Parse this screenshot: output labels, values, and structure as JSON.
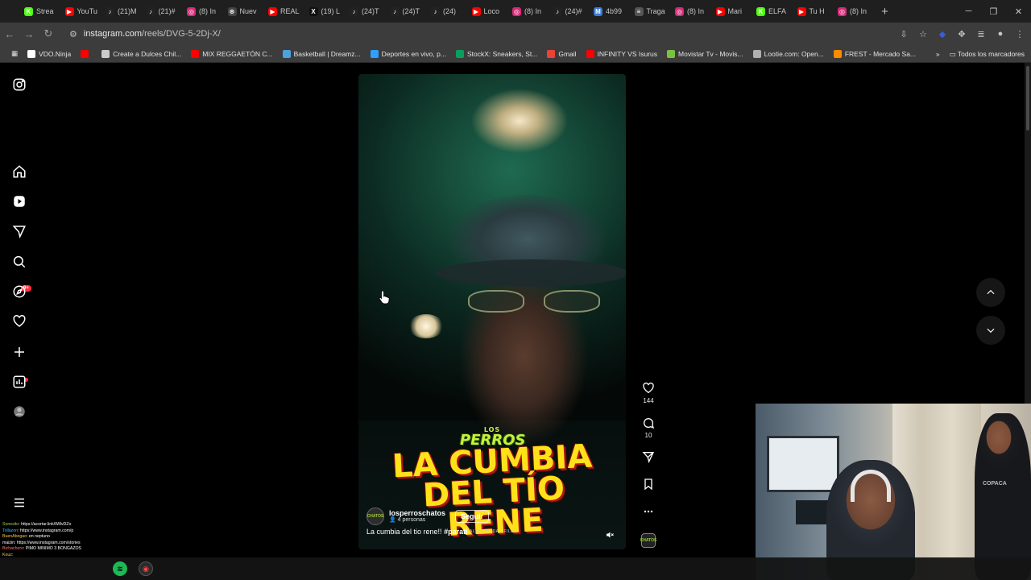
{
  "browser": {
    "tabs": [
      {
        "label": "Strea",
        "fav_color": "#53fc18",
        "fav_glyph": "K",
        "active": false
      },
      {
        "label": "YouTu",
        "fav_color": "#ff0000",
        "fav_glyph": "▶",
        "active": false
      },
      {
        "label": "(21)M",
        "fav_color": "#222222",
        "fav_glyph": "♪",
        "active": false
      },
      {
        "label": "(21)#",
        "fav_color": "#222222",
        "fav_glyph": "♪",
        "active": false
      },
      {
        "label": "(8) In",
        "fav_color": "#d62976",
        "fav_glyph": "◎",
        "active": false
      },
      {
        "label": "Nuev",
        "fav_color": "#444444",
        "fav_glyph": "⊛",
        "active": false
      },
      {
        "label": "REAL",
        "fav_color": "#ff0000",
        "fav_glyph": "▶",
        "active": false
      },
      {
        "label": "(19) L",
        "fav_color": "#111111",
        "fav_glyph": "X",
        "active": false
      },
      {
        "label": "(24)T",
        "fav_color": "#222222",
        "fav_glyph": "♪",
        "active": false
      },
      {
        "label": "(24)T",
        "fav_color": "#222222",
        "fav_glyph": "♪",
        "active": false
      },
      {
        "label": "(24)",
        "fav_color": "#222222",
        "fav_glyph": "♪",
        "active": false
      },
      {
        "label": "Loco",
        "fav_color": "#ff0000",
        "fav_glyph": "▶",
        "active": false
      },
      {
        "label": "(8) In",
        "fav_color": "#d62976",
        "fav_glyph": "◎",
        "active": false
      },
      {
        "label": "(24)#",
        "fav_color": "#222222",
        "fav_glyph": "♪",
        "active": false
      },
      {
        "label": "4b99",
        "fav_color": "#3a7bd5",
        "fav_glyph": "M",
        "active": false
      },
      {
        "label": "Traga",
        "fav_color": "#555555",
        "fav_glyph": "≡",
        "active": false
      },
      {
        "label": "(8) In",
        "fav_color": "#d62976",
        "fav_glyph": "◎",
        "active": false
      },
      {
        "label": "Mari",
        "fav_color": "#ff0000",
        "fav_glyph": "▶",
        "active": false
      },
      {
        "label": "ELFA",
        "fav_color": "#53fc18",
        "fav_glyph": "K",
        "active": false
      },
      {
        "label": "Tu H",
        "fav_color": "#ff0000",
        "fav_glyph": "▶",
        "active": false
      },
      {
        "label": "(8) In",
        "fav_color": "#d62976",
        "fav_glyph": "◎",
        "active": false
      }
    ],
    "new_tab": "+",
    "url_host": "instagram.com",
    "url_path": "/reels/DVG-5-2Dj-X/",
    "bookmarks": [
      {
        "label": "VDO.Ninja",
        "color": "#ffffff"
      },
      {
        "label": "",
        "color": "#ff0000"
      },
      {
        "label": "Create a Dulces Chil...",
        "color": "#cccccc"
      },
      {
        "label": "MIX REGGAETÓN C...",
        "color": "#ff0000"
      },
      {
        "label": "Basketball | Dreamz...",
        "color": "#4aa3df"
      },
      {
        "label": "Deportes en vivo, p...",
        "color": "#2ea0ff"
      },
      {
        "label": "StockX: Sneakers, St...",
        "color": "#08a05c"
      },
      {
        "label": "Gmail",
        "color": "#ea4335"
      },
      {
        "label": "INFINITY VS Isurus",
        "color": "#ff0000"
      },
      {
        "label": "Movistar Tv - Movis...",
        "color": "#7ac142"
      },
      {
        "label": "Lootie.com: Open...",
        "color": "#b0b0b0"
      },
      {
        "label": "FREST - Mercado Sa...",
        "color": "#ff8a00"
      }
    ],
    "all_bookmarks": "Todos los marcadores"
  },
  "sidebar": {
    "notifications_badge": "9+"
  },
  "reel": {
    "logo_line1": "LOS",
    "logo_line2": "PERROS",
    "title_line1": "LA CUMBIA",
    "title_line2": "DEL TÍO RENE",
    "author": "losperroschatos",
    "author_sub": "4 personas",
    "follow_label": "Seguir",
    "caption_text": "La cumbia del tio rene!! ",
    "caption_tag": "#parati",
    "watermark": "ALTA CALIDAD FILMS",
    "avatar_text": "CHATOS",
    "likes": "144",
    "comments": "10"
  },
  "chat": [
    {
      "user": "Sonesito",
      "msg": ": https://acortar.link/W8vDZo",
      "cls": "u1"
    },
    {
      "user": "Tollazon",
      "msg": ": https://www.instagram.com/p",
      "cls": "u2"
    },
    {
      "user": "BuenAbogao",
      "msg": ": en neptuno",
      "cls": "u3"
    },
    {
      "user": "maizin",
      "msg": ": https://www.instagram.com/stories",
      "cls": ""
    },
    {
      "user": "Bichachero",
      "msg": ": PIMO MINIMO 3 BONGAZOS",
      "cls": "u4"
    },
    {
      "user": "Kouz",
      "msg": ":",
      "cls": "u3"
    }
  ],
  "webcam": {
    "shirt_text": "COPACA"
  },
  "colors": {
    "instagram_red": "#ff3040",
    "title_yellow": "#ffe11a",
    "logo_green": "#c8f03a"
  }
}
